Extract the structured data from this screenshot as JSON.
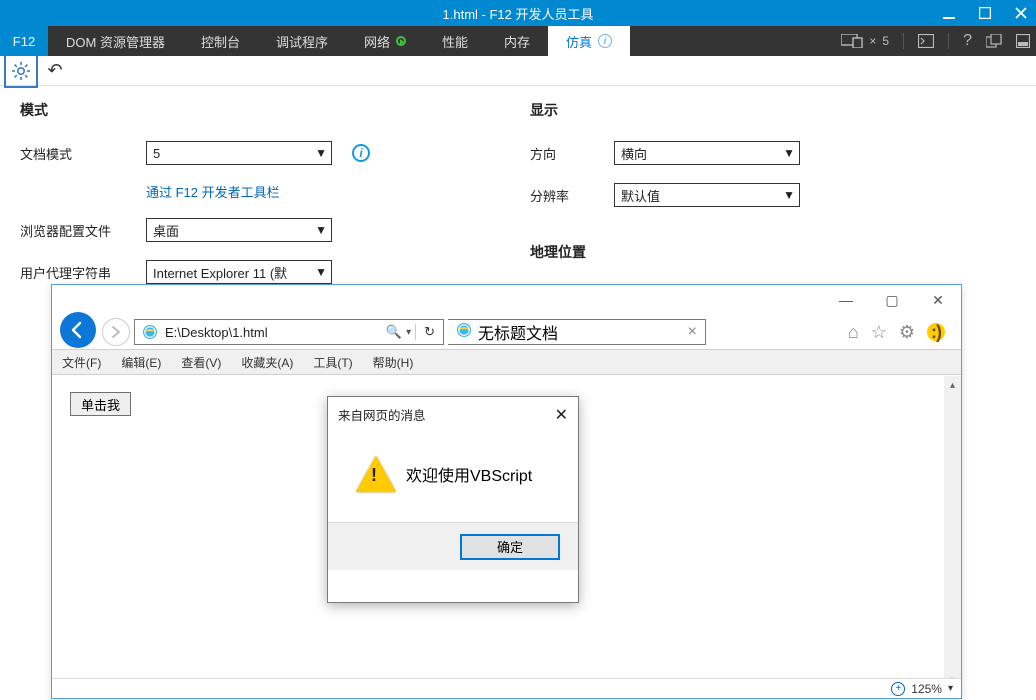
{
  "f12": {
    "title": "1.html - F12 开发人员工具",
    "tabs": {
      "badge": "F12",
      "dom": "DOM 资源管理器",
      "console": "控制台",
      "debugger": "调试程序",
      "network": "网络",
      "perf": "性能",
      "memory": "内存",
      "emulation": "仿真"
    },
    "right_count": "5",
    "mode_title": "模式",
    "docmode_lbl": "文档模式",
    "docmode_val": "5",
    "link": "通过 F12 开发者工具栏",
    "profile_lbl": "浏览器配置文件",
    "profile_val": "桌面",
    "ua_lbl": "用户代理字符串",
    "ua_val": "Internet Explorer 11 (默",
    "display_title": "显示",
    "orient_lbl": "方向",
    "orient_val": "横向",
    "res_lbl": "分辨率",
    "res_val": "默认值",
    "geo_title": "地理位置"
  },
  "ie": {
    "addr": "E:\\Desktop\\1.html",
    "tab_title": "无标题文档",
    "menu": {
      "file": "文件(F)",
      "edit": "编辑(E)",
      "view": "查看(V)",
      "fav": "收藏夹(A)",
      "tools": "工具(T)",
      "help": "帮助(H)"
    },
    "button": "单击我",
    "zoom": "125%"
  },
  "alert": {
    "title": "来自网页的消息",
    "msg": "欢迎使用VBScript",
    "ok": "确定"
  }
}
